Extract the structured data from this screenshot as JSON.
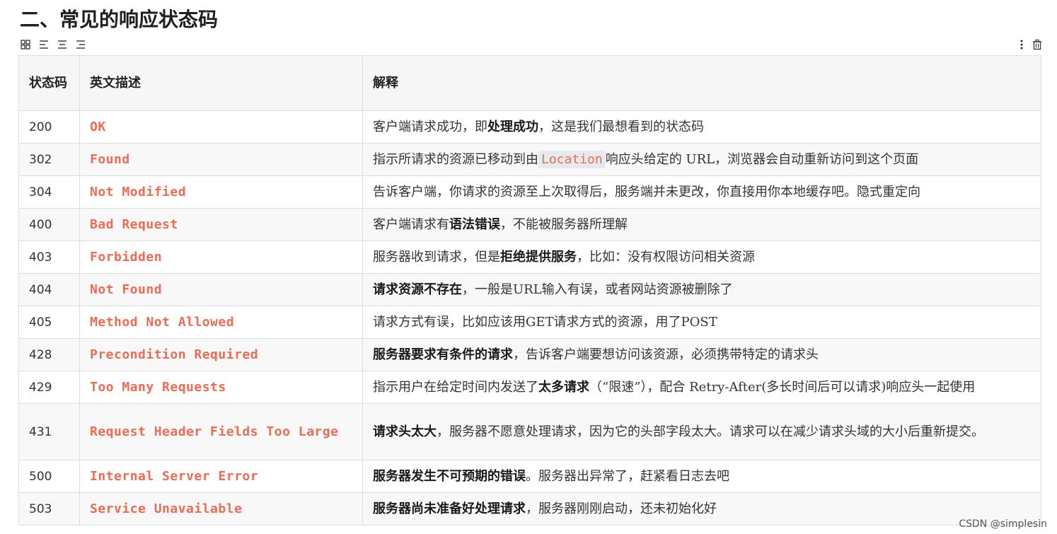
{
  "page": {
    "heading": "二、常见的响应状态码",
    "watermark": "CSDN @simplesin"
  },
  "toolbar": {
    "icons": [
      "grid-icon",
      "align-left-icon",
      "align-center-icon",
      "align-right-icon"
    ],
    "right_icons": [
      "more-vertical-icon",
      "trash-icon"
    ]
  },
  "table": {
    "headers": {
      "code": "状态码",
      "desc": "英文描述",
      "expl": "解释"
    },
    "rows": [
      {
        "code": "200",
        "desc": "OK",
        "e1": "客户端请求成功，即",
        "b1": "处理成功",
        "e2": "，这是我们最想看到的状态码"
      },
      {
        "code": "302",
        "desc": "Found",
        "e1": "指示所请求的资源已移动到由",
        "c1": "Location",
        "e2": "响应头给定的 URL，浏览器会自动重新访问到这个页面"
      },
      {
        "code": "304",
        "desc": "Not Modified",
        "e1": "告诉客户端，你请求的资源至上次取得后，服务端并未更改，你直接用你本地缓存吧。隐式重定向"
      },
      {
        "code": "400",
        "desc": "Bad Request",
        "e1": "客户端请求有",
        "b1": "语法错误",
        "e2": "，不能被服务器所理解"
      },
      {
        "code": "403",
        "desc": "Forbidden",
        "e1": "服务器收到请求，但是",
        "b1": "拒绝提供服务",
        "e2": "，比如：没有权限访问相关资源"
      },
      {
        "code": "404",
        "desc": "Not Found",
        "b1": "请求资源不存在",
        "e2": "，一般是URL输入有误，或者网站资源被删除了"
      },
      {
        "code": "405",
        "desc": "Method Not Allowed",
        "e1": "请求方式有误，比如应该用GET请求方式的资源，用了POST"
      },
      {
        "code": "428",
        "desc": "Precondition Required",
        "b1": "服务器要求有条件的请求",
        "e2": "，告诉客户端要想访问该资源，必须携带特定的请求头"
      },
      {
        "code": "429",
        "desc": "Too Many Requests",
        "e1": "指示用户在给定时间内发送了",
        "b1": "太多请求",
        "e2": "（“限速”），配合 Retry-After(多长时间后可以请求)响应头一起使用"
      },
      {
        "code": "431",
        "desc": "Request Header Fields Too Large",
        "b1": "请求头太大",
        "e2": "，服务器不愿意处理请求，因为它的头部字段太大。请求可以在减少请求头域的大小后重新提交。"
      },
      {
        "code": "500",
        "desc": "Internal Server Error",
        "b1": "服务器发生不可预期的错误",
        "e2": "。服务器出异常了，赶紧看日志去吧"
      },
      {
        "code": "503",
        "desc": "Service Unavailable",
        "b1": "服务器尚未准备好处理请求",
        "e2": "，服务器刚刚启动，还未初始化好"
      }
    ]
  }
}
